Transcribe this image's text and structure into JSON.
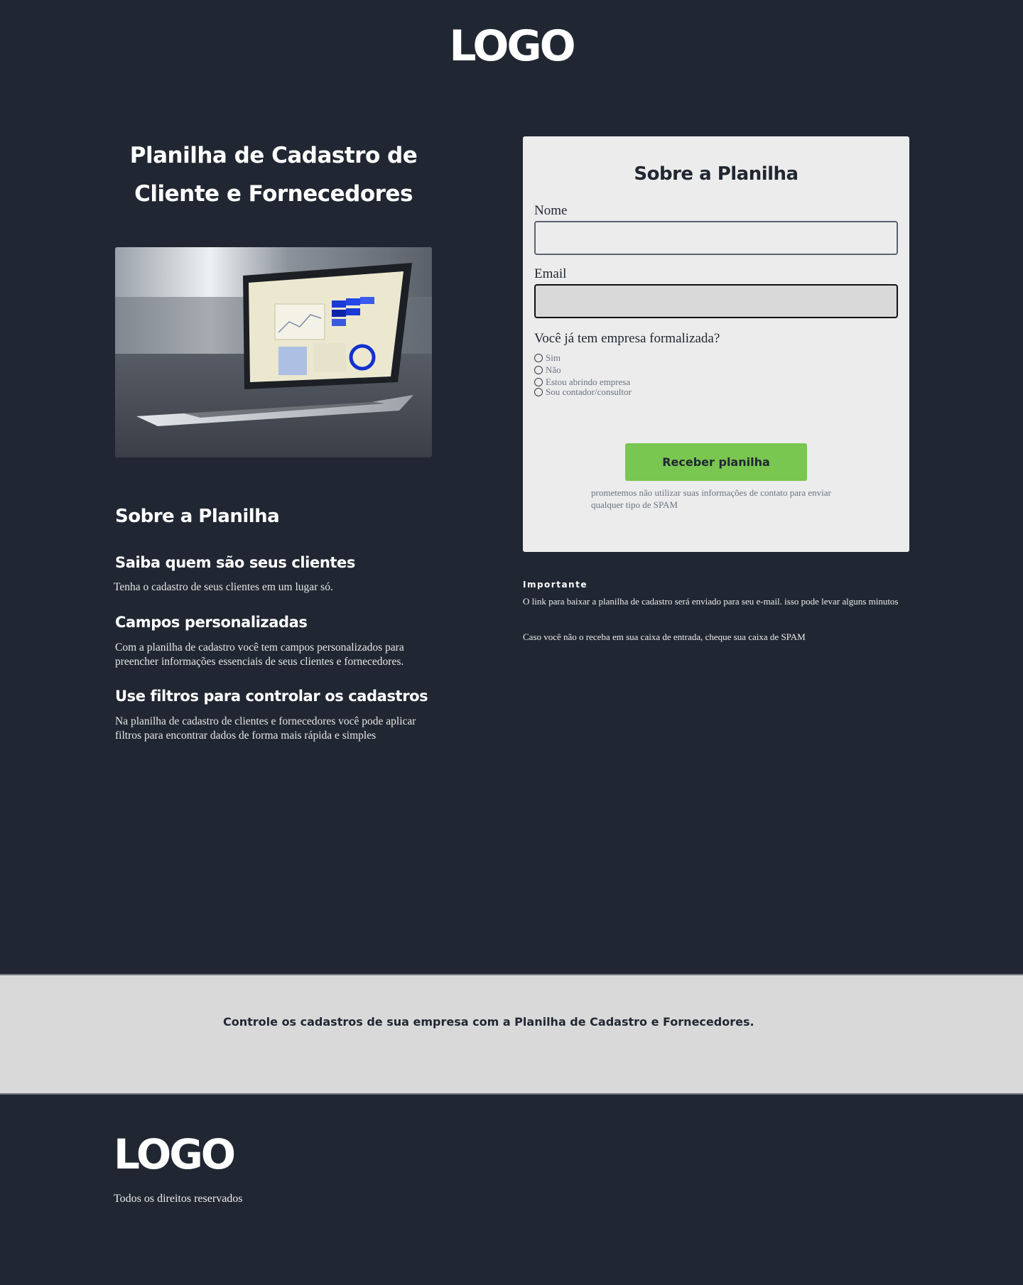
{
  "header": {
    "logo": "LOGO"
  },
  "hero": {
    "title": "Planilha de Cadastro de Cliente e Fornecedores",
    "image_alt": "laptop-with-dashboard"
  },
  "about": {
    "heading": "Sobre a Planilha",
    "features": [
      {
        "title": "Saiba quem são seus clientes",
        "text": "Tenha o cadastro de seus clientes em um lugar só."
      },
      {
        "title": "Campos personalizadas",
        "text": "Com a planilha de cadastro você tem campos personalizados para preencher informações essenciais de seus clientes e fornecedores."
      },
      {
        "title": "Use filtros para controlar os cadastros",
        "text": "Na planilha de cadastro de clientes e fornecedores você pode aplicar filtros para encontrar dados de forma mais rápida e simples"
      }
    ]
  },
  "form": {
    "heading": "Sobre a Planilha",
    "name_label": "Nome",
    "name_value": "",
    "email_label": "Email",
    "email_value": "",
    "question": "Você já tem empresa formalizada?",
    "options": [
      "Sim",
      "Não",
      "Estou abrindo empresa",
      "Sou contador/consultor"
    ],
    "submit_label": "Receber planilha",
    "privacy_note": "prometemos não utilizar suas informações de contato para enviar qualquer tipo de SPAM"
  },
  "important": {
    "label": "Importante",
    "text1": "O link para baixar a planilha de cadastro será enviado para seu e-mail. isso pode levar alguns minutos",
    "text2": "Caso você não o receba em sua caixa de entrada, cheque sua caixa de SPAM"
  },
  "banner": {
    "text": "Controle os cadastros de sua empresa com a Planilha de Cadastro e Fornecedores."
  },
  "footer": {
    "logo": "LOGO",
    "copyright": "Todos os direitos reservados"
  },
  "colors": {
    "background": "#212732",
    "card": "#ececec",
    "accent": "#79c650",
    "banner": "#d9d9d9"
  }
}
